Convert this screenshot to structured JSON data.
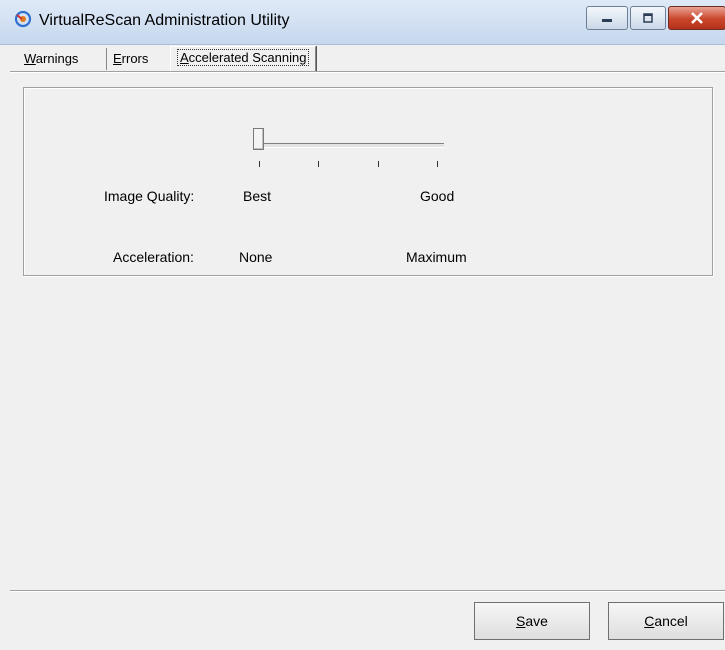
{
  "window": {
    "title": "VirtualReScan Administration Utility",
    "controls": [
      "minimize",
      "maximize",
      "close"
    ]
  },
  "tabs": [
    {
      "label": "Warnings",
      "mnemonic": "W",
      "rest": "arnings",
      "selected": false
    },
    {
      "label": "Errors",
      "mnemonic": "E",
      "rest": "rrors",
      "selected": false
    },
    {
      "label": "Accelerated Scanning",
      "mnemonic": "A",
      "rest": "ccelerated Scanning",
      "selected": true
    }
  ],
  "settings": {
    "image_quality_label": "Image Quality:",
    "image_quality_min": "Best",
    "image_quality_max": "Good",
    "acceleration_label": "Acceleration:",
    "acceleration_min": "None",
    "acceleration_max": "Maximum",
    "slider_position": 0,
    "slider_ticks": 4
  },
  "buttons": {
    "save": {
      "label": "Save",
      "mnemonic": "S",
      "rest": "ave"
    },
    "cancel": {
      "label": "Cancel",
      "mnemonic": "C",
      "rest": "ancel"
    }
  },
  "colors": {
    "titlebar": "#c6d8ee",
    "close_button": "#c9452b",
    "background": "#f0f0f0"
  }
}
